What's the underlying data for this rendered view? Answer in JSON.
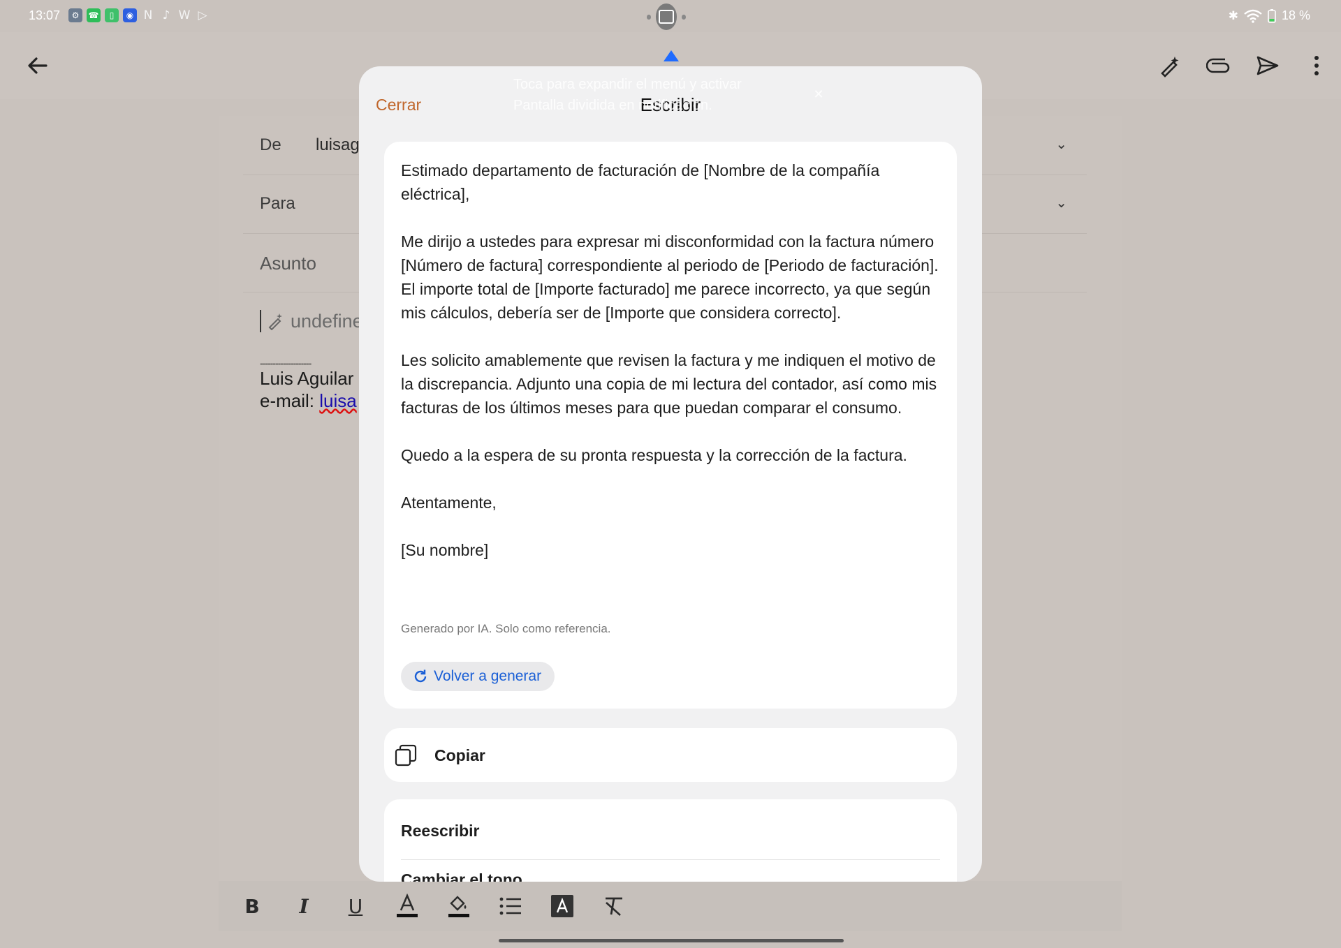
{
  "status_bar": {
    "time": "13:07",
    "battery": "18 %",
    "notification_icons": [
      "settings-icon",
      "phone-icon",
      "battery-app-icon",
      "broadcast-icon",
      "netflix-icon",
      "mic-icon",
      "w-icon",
      "play-icon"
    ]
  },
  "app_bar": {
    "actions": [
      "magic-pen-icon",
      "attach-icon",
      "send-icon",
      "more-icon"
    ]
  },
  "compose": {
    "from_label": "De",
    "from_value": "luisag",
    "to_label": "Para",
    "subject_label": "Asunto",
    "body_hint": "undefine",
    "signature_dashes": "--------------------",
    "signature_name": "Luis Aguilar",
    "signature_email_label": "e-mail: ",
    "signature_email": "luisa"
  },
  "tooltip": {
    "line1": "Toca para expandir el menú y activar",
    "line2": "Pantalla dividida en notificación."
  },
  "dialog": {
    "close_label": "Cerrar",
    "title": "Escribir",
    "generated_paragraphs": [
      "Estimado departamento de facturación de [Nombre de la compañía eléctrica],",
      "Me dirijo a ustedes para expresar mi disconformidad con la factura número [Número de factura] correspondiente al periodo de [Periodo de facturación]. El importe total de [Importe facturado] me parece incorrecto, ya que según mis cálculos, debería ser de [Importe que considera correcto].",
      "Les solicito amablemente que revisen la factura y me indiquen el motivo de la discrepancia. Adjunto una copia de mi lectura del contador, así como mis facturas de los últimos meses para que puedan comparar el consumo.",
      "Quedo a la espera de su pronta respuesta y la corrección de la factura.",
      "Atentamente,",
      "[Su nombre]"
    ],
    "ai_note": "Generado por IA. Solo como referencia.",
    "regenerate_label": "Volver a generar",
    "copy_label": "Copiar",
    "rewrite_label": "Reescribir",
    "change_tone_label": "Cambiar el tono"
  },
  "format_toolbar": {
    "bold": "B",
    "italic": "I",
    "underline": "U",
    "text_color": "A",
    "text_style": "A"
  },
  "colors": {
    "accent_close": "#c0662b",
    "accent_link": "#1a5fd6",
    "tooltip_arrow": "#1f6bff"
  }
}
